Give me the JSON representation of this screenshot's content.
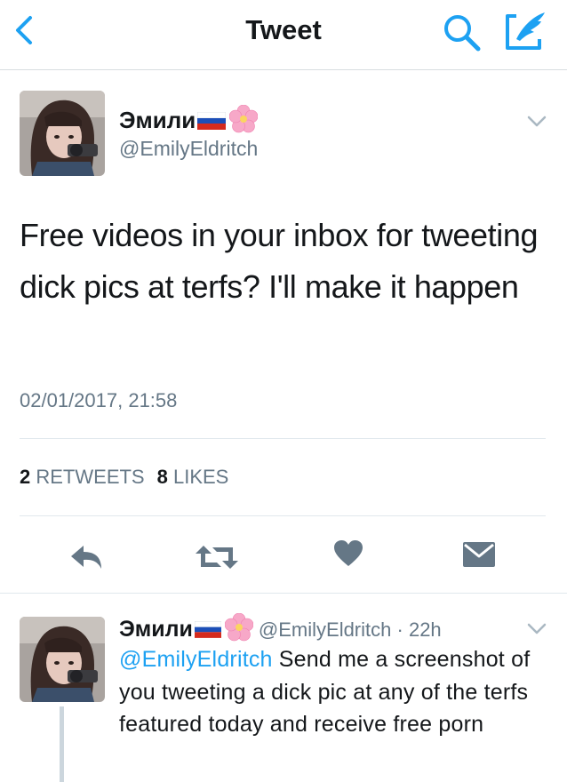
{
  "topbar": {
    "title": "Tweet",
    "back_icon": "chevron-left-icon",
    "search_icon": "search-icon",
    "compose_icon": "compose-tweet-icon"
  },
  "tweet": {
    "author_name": "Эмили",
    "author_handle": "@EmilyEldritch",
    "text": "Free videos in your inbox for tweeting dick pics at terfs? I'll make it happen",
    "timestamp": "02/01/2017, 21:58",
    "retweet_count": "2",
    "retweet_label": "RETWEETS",
    "like_count": "8",
    "like_label": "LIKES"
  },
  "reply": {
    "author_name": "Эмили",
    "author_handle": "@EmilyEldritch",
    "separator": "·",
    "time_ago": "22h",
    "mention": "@EmilyEldritch",
    "text": " Send me a screenshot of you tweeting a dick pic at any of the terfs featured today and receive free porn"
  },
  "colors": {
    "accent": "#1da1f2",
    "text": "#14171a",
    "secondary": "#657786",
    "icon_gray": "#657786",
    "divider": "#e1e8ed"
  }
}
